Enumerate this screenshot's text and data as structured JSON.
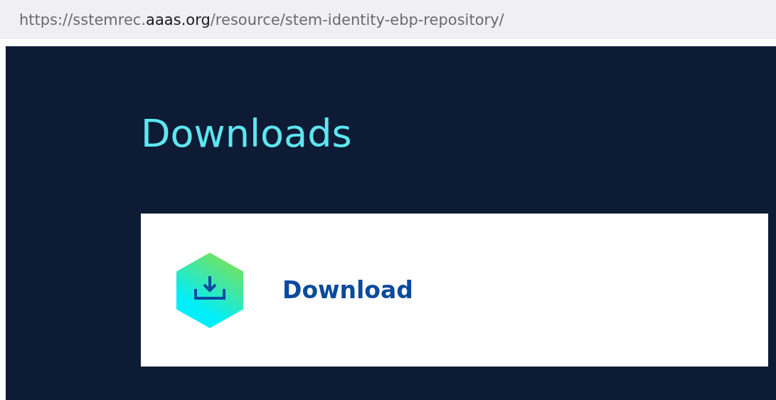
{
  "address_bar": {
    "url_parts": [
      {
        "text": "https://sstemrec.",
        "emphasis": false
      },
      {
        "text": "aaas.org",
        "emphasis": true
      },
      {
        "text": "/resource/stem-identity-ebp-repository/",
        "emphasis": false
      }
    ]
  },
  "section": {
    "heading": "Downloads"
  },
  "downloads": [
    {
      "label": "Download"
    }
  ]
}
